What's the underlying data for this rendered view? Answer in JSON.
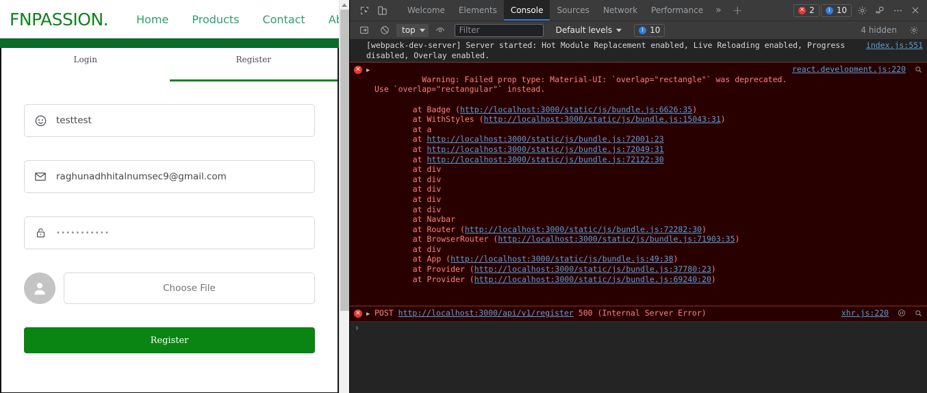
{
  "website": {
    "brand": "FNPASSION.",
    "nav_links": [
      "Home",
      "Products",
      "Contact",
      "About"
    ],
    "tabs": [
      {
        "label": "Login",
        "active": false
      },
      {
        "label": "Register",
        "active": true
      }
    ],
    "form": {
      "username": {
        "icon": "user-circle-icon",
        "value": "testtest"
      },
      "email": {
        "icon": "envelope-icon",
        "value": "raghunadhhitalnumsec9@gmail.com"
      },
      "password": {
        "icon": "lock-icon",
        "value": "•••••••••••"
      },
      "file": {
        "icon": "avatar-placeholder-icon",
        "label": "Choose File"
      },
      "submit_label": "Register"
    },
    "colors": {
      "brand_green": "#11821e",
      "bar_green": "#0b6b2a",
      "button_green": "#0a8412",
      "nav_link": "#2f9e6b"
    }
  },
  "devtools": {
    "topbar": {
      "inspect_icon": "inspect-element-icon",
      "device_icon": "device-toolbar-icon",
      "tabs": [
        "Welcome",
        "Elements",
        "Console",
        "Sources",
        "Network",
        "Performance"
      ],
      "active_tab": "Console",
      "more_tabs_icon": "chevron-double-right-icon",
      "add_tab_icon": "plus-icon",
      "error_count": "2",
      "info_count": "10",
      "settings_icon": "gear-icon",
      "customize_icon": "devtools-dock-icon",
      "menu_icon": "kebab-menu-icon",
      "close_icon": "close-icon"
    },
    "filterbar": {
      "clear_icon": "clear-console-icon",
      "no_entry_icon": "no-entry-icon",
      "context": "top",
      "eye_icon": "live-expression-icon",
      "filter_placeholder": "Filter",
      "filter_value": "",
      "levels_label": "Default levels",
      "info_count": "10",
      "hidden_label": "4 hidden",
      "settings_icon": "console-settings-gear-icon"
    },
    "messages": [
      {
        "type": "info",
        "text": "[webpack-dev-server] Server started: Hot Module Replacement enabled, Live Reloading enabled, Progress disabled, Overlay enabled.",
        "source": "index.js:551"
      },
      {
        "type": "error",
        "text": "Warning: Failed prop type: Material-UI: `overlap=\"rectangle\"` was deprecated. Use `overlap=\"rectangular\"` instead.",
        "source": "react.development.js:220",
        "has_search_icon": true,
        "stack": [
          {
            "prefix": "    at Badge (",
            "link": "http://localhost:3000/static/js/bundle.js:6626:35",
            "suffix": ")"
          },
          {
            "prefix": "    at WithStyles (",
            "link": "http://localhost:3000/static/js/bundle.js:15043:31",
            "suffix": ")"
          },
          {
            "prefix": "    at a",
            "link": "",
            "suffix": ""
          },
          {
            "prefix": "    at ",
            "link": "http://localhost:3000/static/js/bundle.js:72001:23",
            "suffix": ""
          },
          {
            "prefix": "    at ",
            "link": "http://localhost:3000/static/js/bundle.js:72049:31",
            "suffix": ""
          },
          {
            "prefix": "    at ",
            "link": "http://localhost:3000/static/js/bundle.js:72122:30",
            "suffix": ""
          },
          {
            "prefix": "    at div",
            "link": "",
            "suffix": ""
          },
          {
            "prefix": "    at div",
            "link": "",
            "suffix": ""
          },
          {
            "prefix": "    at div",
            "link": "",
            "suffix": ""
          },
          {
            "prefix": "    at div",
            "link": "",
            "suffix": ""
          },
          {
            "prefix": "    at div",
            "link": "",
            "suffix": ""
          },
          {
            "prefix": "    at Navbar",
            "link": "",
            "suffix": ""
          },
          {
            "prefix": "    at Router (",
            "link": "http://localhost:3000/static/js/bundle.js:72282:30",
            "suffix": ")"
          },
          {
            "prefix": "    at BrowserRouter (",
            "link": "http://localhost:3000/static/js/bundle.js:71903:35",
            "suffix": ")"
          },
          {
            "prefix": "    at div",
            "link": "",
            "suffix": ""
          },
          {
            "prefix": "    at App (",
            "link": "http://localhost:3000/static/js/bundle.js:49:38",
            "suffix": ")"
          },
          {
            "prefix": "    at Provider (",
            "link": "http://localhost:3000/static/js/bundle.js:37780:23",
            "suffix": ")"
          },
          {
            "prefix": "    at Provider (",
            "link": "http://localhost:3000/static/js/bundle.js:69240:20",
            "suffix": ")"
          }
        ]
      },
      {
        "type": "error-network",
        "method": "POST",
        "url": "http://localhost:3000/api/v1/register",
        "status": "500 (Internal Server Error)",
        "source": "xhr.js:220",
        "has_network_icon": true,
        "has_search_icon": true
      }
    ],
    "prompt_caret": "›"
  }
}
